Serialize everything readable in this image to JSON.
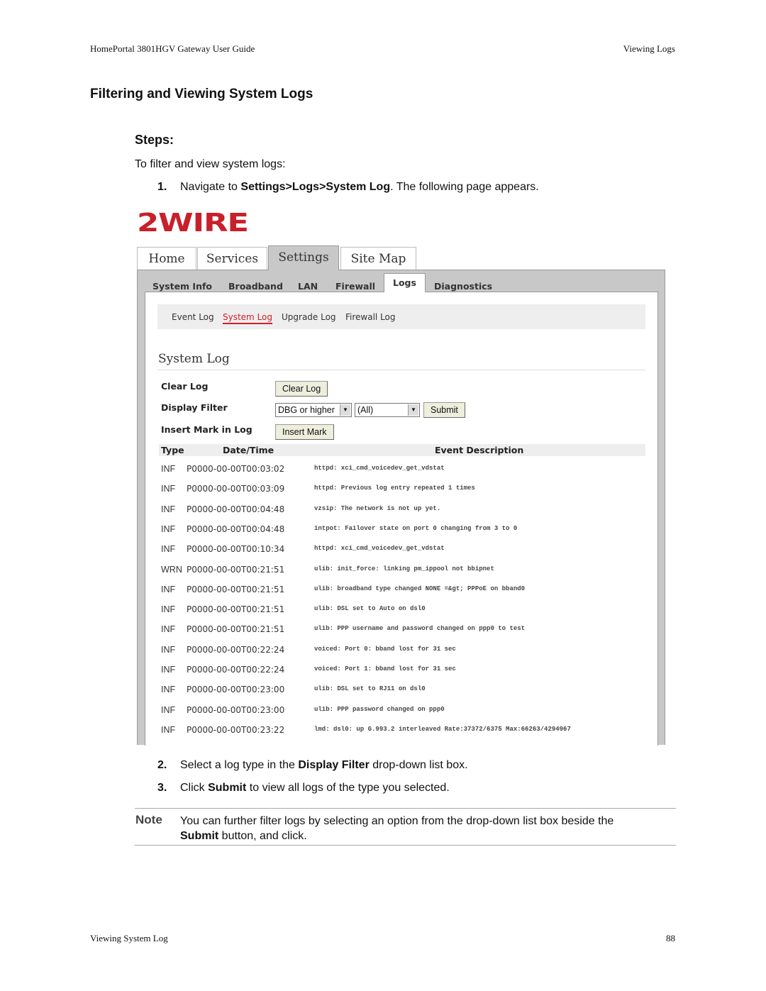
{
  "header": {
    "left": "HomePortal 3801HGV Gateway User Guide",
    "right": "Viewing Logs"
  },
  "title": "Filtering and Viewing System Logs",
  "steps_heading": "Steps:",
  "intro": "To filter and view system logs:",
  "steps": [
    {
      "num": "1.",
      "pre": "Navigate to ",
      "bold": "Settings>Logs>System Log",
      "post": ". The following page appears."
    },
    {
      "num": "2.",
      "pre": "Select a log type in the ",
      "bold": "Display Filter",
      "post": " drop-down list box."
    },
    {
      "num": "3.",
      "pre": "Click ",
      "bold": "Submit",
      "post": " to view all logs of the type you selected."
    }
  ],
  "note": {
    "label": "Note",
    "line1": "You can further filter logs by selecting an option from the drop-down list box beside the",
    "bold": "Submit",
    "line2": " button, and click."
  },
  "footer": {
    "left": "Viewing System Log",
    "right": "88"
  },
  "screenshot": {
    "logo": "2WIRE",
    "brand_color": "#c8202a",
    "main_tabs": [
      "Home",
      "Services",
      "Settings",
      "Site Map"
    ],
    "sub_tabs": [
      "System Info",
      "Broadband",
      "LAN",
      "Firewall",
      "Logs",
      "Diagnostics"
    ],
    "log_nav": [
      "Event Log",
      "System Log",
      "Upgrade Log",
      "Firewall Log"
    ],
    "section_title": "System Log",
    "clear_log_label": "Clear Log",
    "clear_log_button": "Clear Log",
    "display_filter_label": "Display Filter",
    "filter_level": "DBG or higher",
    "filter_source": "(All)",
    "submit": "Submit",
    "insert_mark_label": "Insert Mark in Log",
    "insert_mark_button": "Insert Mark",
    "columns": [
      "Type",
      "Date/Time",
      "Event Description"
    ],
    "rows": [
      {
        "type": "INF",
        "date": "P0000-00-00T00:03:02",
        "desc": "httpd: xci_cmd_voicedev_get_vdstat"
      },
      {
        "type": "INF",
        "date": "P0000-00-00T00:03:09",
        "desc": "httpd: Previous log entry repeated 1 times"
      },
      {
        "type": "INF",
        "date": "P0000-00-00T00:04:48",
        "desc": "vzsip: The network is not up yet."
      },
      {
        "type": "INF",
        "date": "P0000-00-00T00:04:48",
        "desc": "intpot: Failover state on port 0 changing from 3 to 0"
      },
      {
        "type": "INF",
        "date": "P0000-00-00T00:10:34",
        "desc": "httpd: xci_cmd_voicedev_get_vdstat"
      },
      {
        "type": "WRN",
        "date": "P0000-00-00T00:21:51",
        "desc": "ulib: init_force: linking pm_ippool not bbipnet"
      },
      {
        "type": "INF",
        "date": "P0000-00-00T00:21:51",
        "desc": "ulib: broadband type changed NONE =&gt; PPPoE on bband0"
      },
      {
        "type": "INF",
        "date": "P0000-00-00T00:21:51",
        "desc": "ulib: DSL set to Auto on dsl0"
      },
      {
        "type": "INF",
        "date": "P0000-00-00T00:21:51",
        "desc": "ulib: PPP username and password changed on ppp0 to test"
      },
      {
        "type": "INF",
        "date": "P0000-00-00T00:22:24",
        "desc": "voiced: Port 0: bband lost for 31 sec"
      },
      {
        "type": "INF",
        "date": "P0000-00-00T00:22:24",
        "desc": "voiced: Port 1: bband lost for 31 sec"
      },
      {
        "type": "INF",
        "date": "P0000-00-00T00:23:00",
        "desc": "ulib: DSL set to RJ11 on dsl0"
      },
      {
        "type": "INF",
        "date": "P0000-00-00T00:23:00",
        "desc": "ulib: PPP password changed on ppp0"
      },
      {
        "type": "INF",
        "date": "P0000-00-00T00:23:22",
        "desc": "lmd: dsl0: up G.993.2 interleaved Rate:37372/6375 Max:66263/4294967"
      }
    ]
  }
}
